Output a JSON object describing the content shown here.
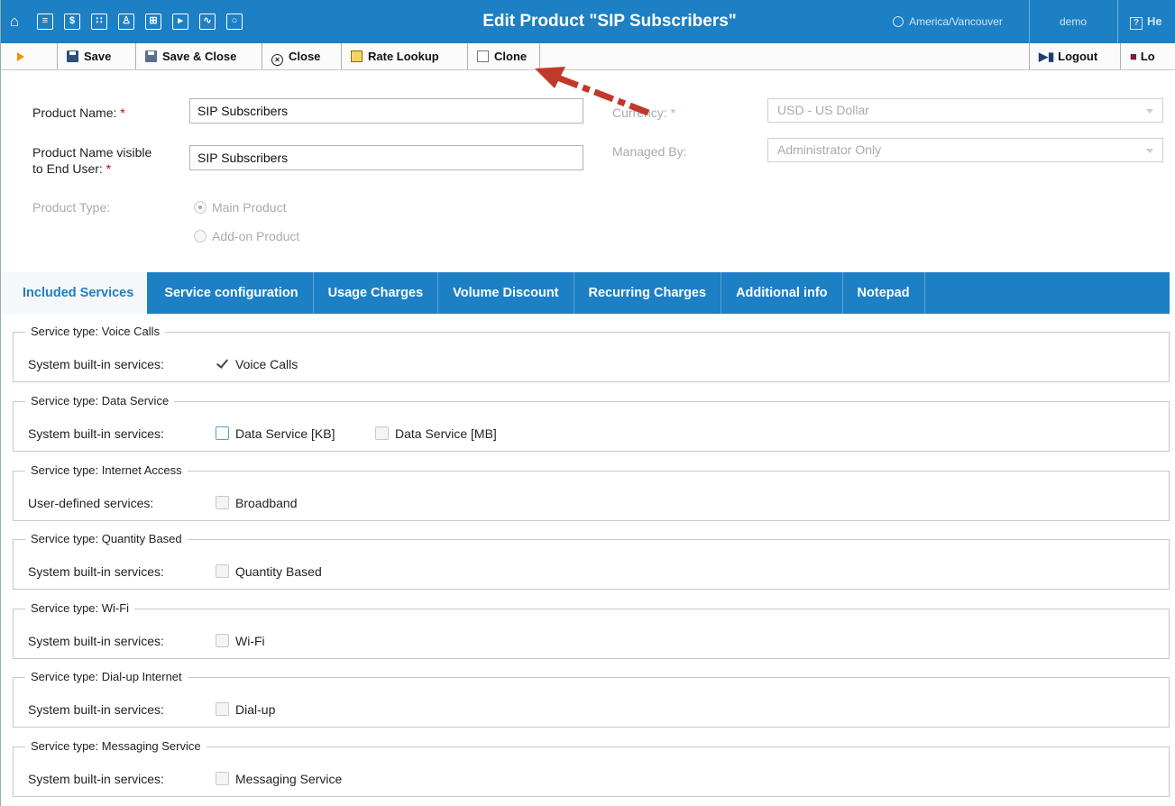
{
  "header": {
    "title": "Edit Product \"SIP Subscribers\"",
    "timezone": "America/Vancouver",
    "user": "demo",
    "help_label": "He",
    "nav_icons": [
      "home-icon",
      "list-icon",
      "dollar-icon",
      "grid-icon",
      "person-icon",
      "hierarchy-icon",
      "forward-icon",
      "chart-icon",
      "search-icon"
    ]
  },
  "toolbar": {
    "save": "Save",
    "save_close": "Save & Close",
    "close": "Close",
    "rate_lookup": "Rate Lookup",
    "clone": "Clone",
    "logout": "Logout",
    "log_partial": "Lo"
  },
  "form": {
    "product_name_label": "Product Name:",
    "product_name_value": "SIP Subscribers",
    "visible_name_label_line1": "Product Name visible",
    "visible_name_label_line2": "to End User:",
    "visible_name_value": "SIP Subscribers",
    "currency_label": "Currency:",
    "currency_value": "USD - US Dollar",
    "managed_by_label": "Managed By:",
    "managed_by_value": "Administrator Only",
    "product_type_label": "Product Type:",
    "product_type_options": [
      "Main Product",
      "Add-on Product"
    ],
    "product_type_selected": "Main Product",
    "required_mark": "*"
  },
  "tabs": [
    "Included Services",
    "Service configuration",
    "Usage Charges",
    "Volume Discount",
    "Recurring Charges",
    "Additional info",
    "Notepad"
  ],
  "active_tab": "Included Services",
  "services": [
    {
      "legend": "Service type: Voice Calls",
      "row_label": "System built-in services:",
      "items": [
        {
          "label": "Voice Calls",
          "checked": true
        }
      ]
    },
    {
      "legend": "Service type: Data Service",
      "row_label": "System built-in services:",
      "items": [
        {
          "label": "Data Service [KB]",
          "checked": false
        },
        {
          "label": "Data Service [MB]",
          "checked": false
        }
      ]
    },
    {
      "legend": "Service type: Internet Access",
      "row_label": "User-defined services:",
      "items": [
        {
          "label": "Broadband",
          "checked": false
        }
      ]
    },
    {
      "legend": "Service type: Quantity Based",
      "row_label": "System built-in services:",
      "items": [
        {
          "label": "Quantity Based",
          "checked": false
        }
      ]
    },
    {
      "legend": "Service type: Wi-Fi",
      "row_label": "System built-in services:",
      "items": [
        {
          "label": "Wi-Fi",
          "checked": false
        }
      ]
    },
    {
      "legend": "Service type: Dial-up Internet",
      "row_label": "System built-in services:",
      "items": [
        {
          "label": "Dial-up",
          "checked": false
        }
      ]
    },
    {
      "legend": "Service type: Messaging Service",
      "row_label": "System built-in services:",
      "items": [
        {
          "label": "Messaging Service",
          "checked": false
        }
      ]
    }
  ],
  "colors": {
    "primary": "#1d7fc4",
    "annotation_arrow": "#c0392b"
  }
}
